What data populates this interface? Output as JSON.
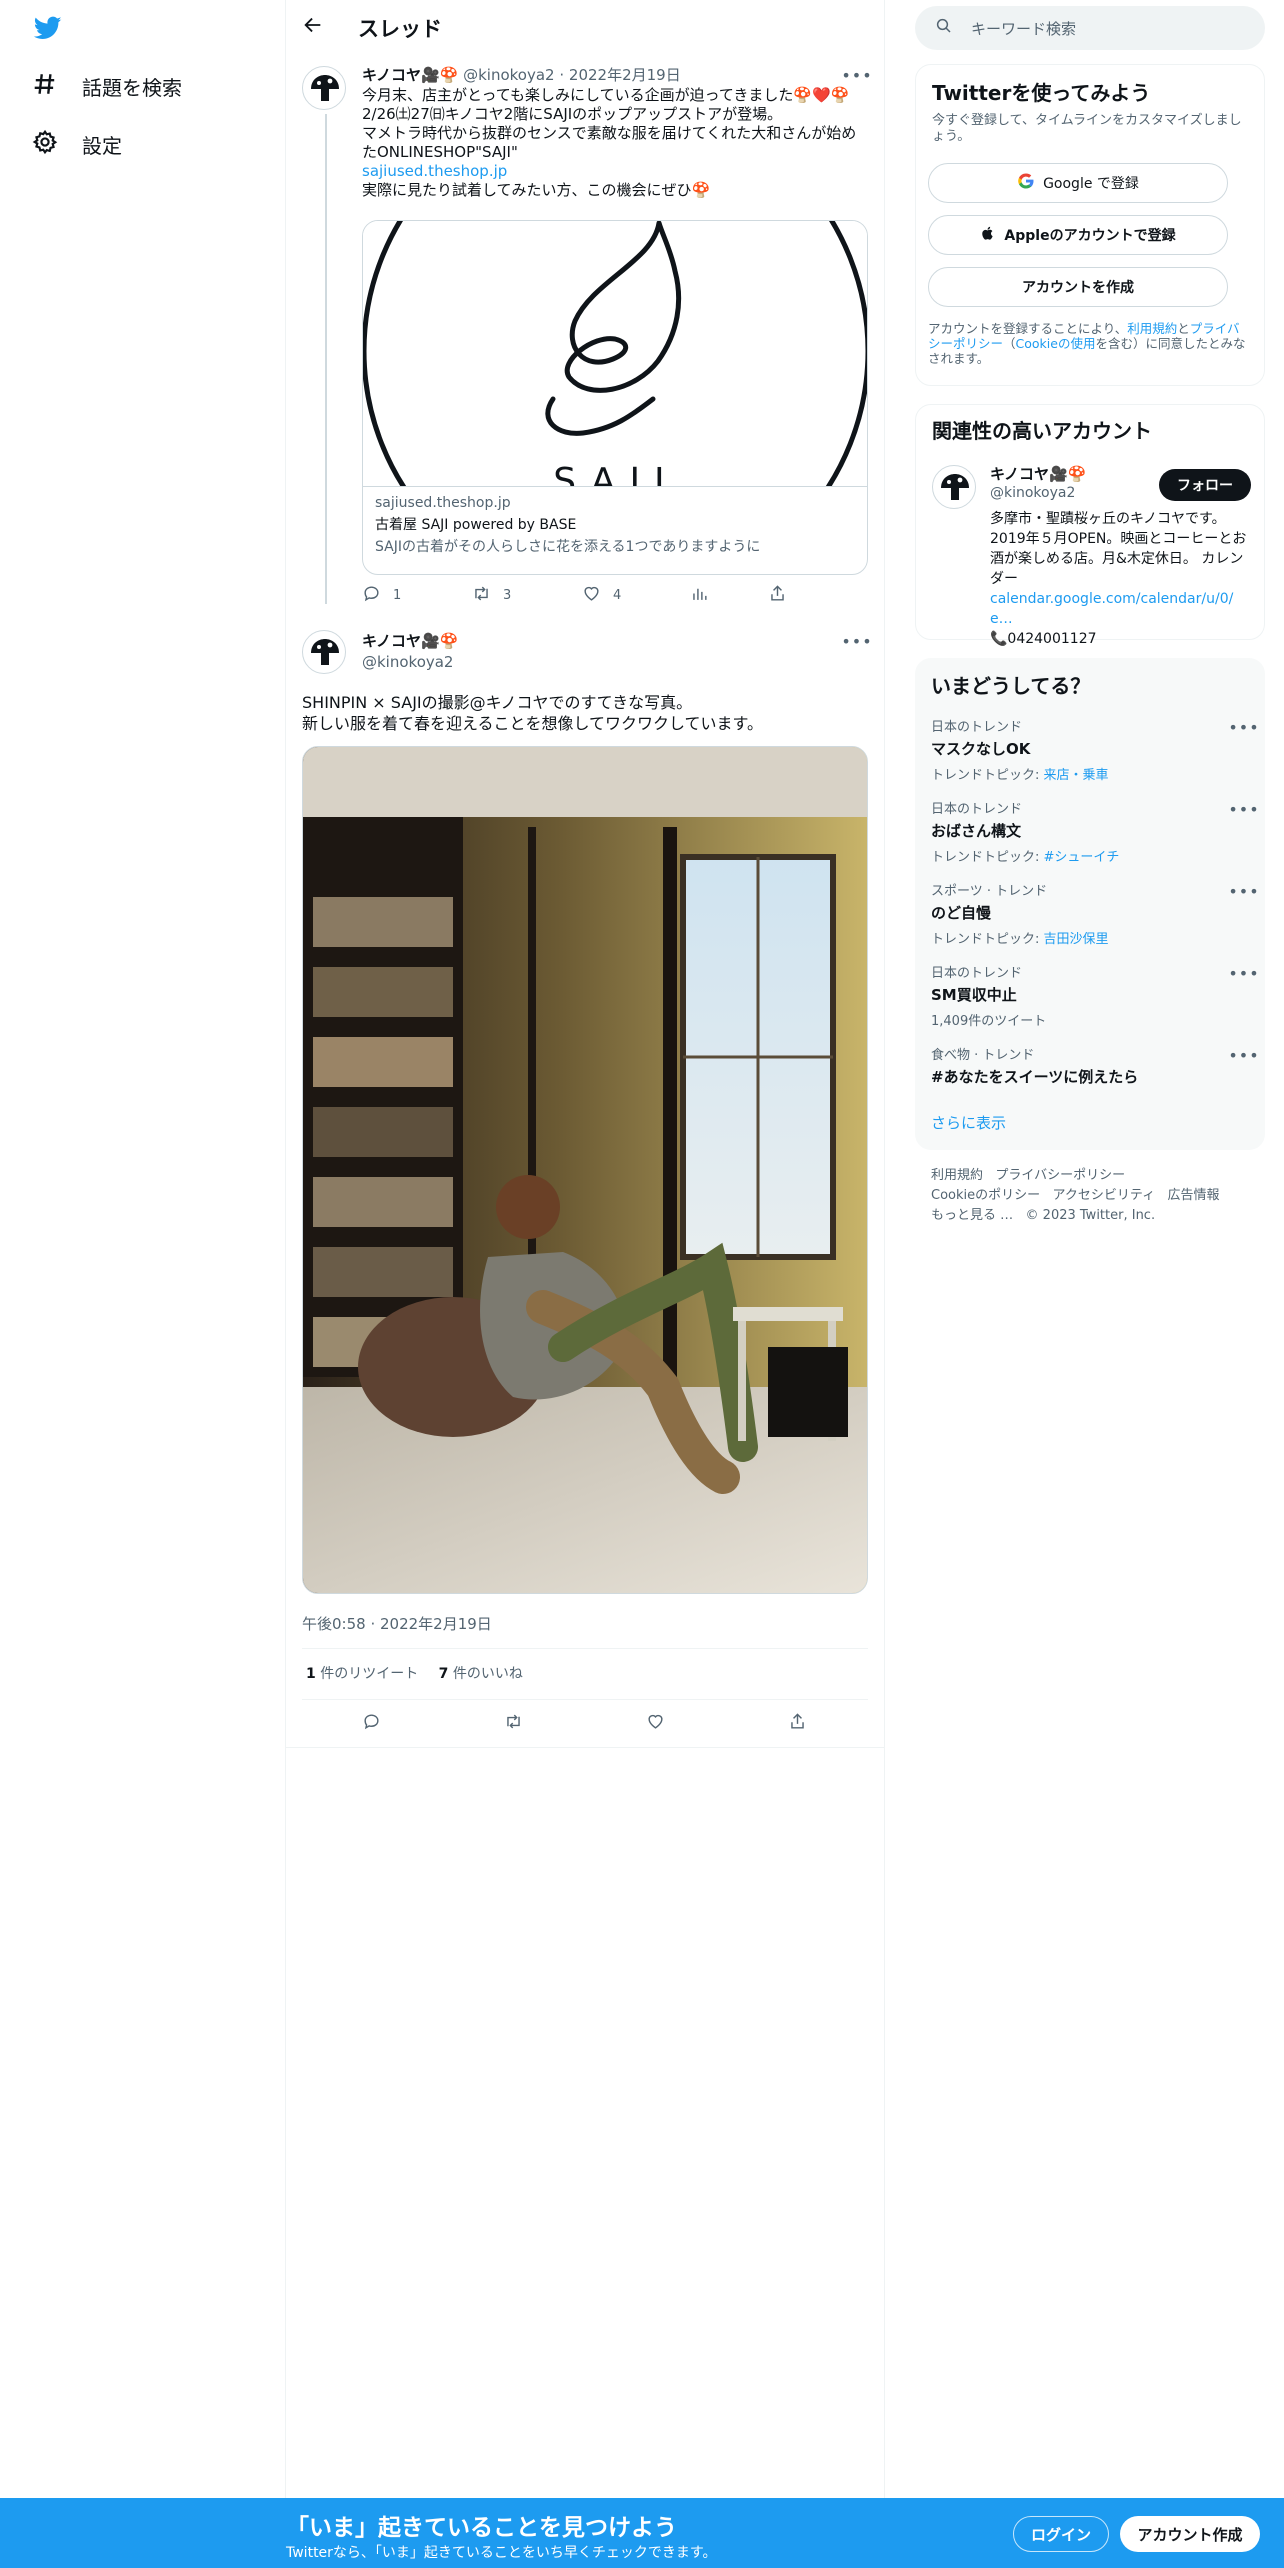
{
  "nav": {
    "items": [
      {
        "label": "話題を検索",
        "icon": "hashtag-icon"
      },
      {
        "label": "設定",
        "icon": "gear-icon"
      }
    ]
  },
  "header": {
    "title": "スレッド"
  },
  "tweet1": {
    "name": "キノコヤ🎥🍄",
    "handle": "@kinokoya2",
    "sep": "·",
    "date": "2022年2月19日",
    "lines": [
      "今月末、店主がとっても楽しみにしている企画が迫ってきました🍄❤️🍄",
      "2/26㈯27㈰キノコヤ2階にSAJIのポップアップストアが登場。",
      "マメトラ時代から抜群のセンスで素敵な服を届けてくれた大和さんが始めたONLINESHOP\"SAJI\""
    ],
    "link": "sajiused.theshop.jp",
    "line_last": "実際に見たり試着してみたい方、この機会にぜひ🍄",
    "card": {
      "image_text": "SAJI",
      "domain": "sajiused.theshop.jp",
      "title": "古着屋 SAJI powered by BASE",
      "desc": "SAJIの古着がその人らしさに花を添える1つでありますように"
    },
    "reply_count": "1",
    "retweet_count": "3",
    "like_count": "4"
  },
  "tweet2": {
    "name": "キノコヤ🎥🍄",
    "handle": "@kinokoya2",
    "text1": "SHINPIN × SAJIの撮影@キノコヤでのすてきな写真。",
    "text2": "新しい服を着て春を迎えることを想像してワクワクしています。",
    "timestamp": "午後0:58 · 2022年2月19日",
    "retweets_num": "1",
    "retweets_label": "件のリツイート",
    "likes_num": "7",
    "likes_label": "件のいいね"
  },
  "right": {
    "search_placeholder": "キーワード検索",
    "signup": {
      "title": "Twitterを使ってみよう",
      "subtitle": "今すぐ登録して、タイムラインをカスタマイズしましょう。",
      "google": "Google で登録",
      "apple": "Appleのアカウントで登録",
      "create": "アカウントを作成",
      "legal_1": "アカウントを登録することにより、",
      "legal_terms": "利用規約",
      "legal_2": "と",
      "legal_privacy": "プライバシーポリシー",
      "legal_3": "（",
      "legal_cookie": "Cookieの使用",
      "legal_4": "を含む）に同意したとみなされます。"
    },
    "relevant": {
      "title": "関連性の高いアカウント",
      "name": "キノコヤ🎥🍄",
      "handle": "@kinokoya2",
      "follow": "フォロー",
      "bio": "多摩市・聖蹟桜ヶ丘のキノコヤです。2019年５月OPEN。映画とコーヒーとお酒が楽しめる店。月&木定休日。 カレンダー",
      "bio_link": "calendar.google.com/calendar/u/0/e…",
      "phone": "📞0424001127"
    },
    "trends": {
      "title": "いまどうしてる？",
      "items": [
        {
          "meta": "日本のトレンド",
          "title": "マスクなしOK",
          "sub_prefix": "トレンドトピック: ",
          "sub_link": "来店・乗車",
          "sub": ""
        },
        {
          "meta": "日本のトレンド",
          "title": "おばさん構文",
          "sub_prefix": "トレンドトピック: ",
          "sub_link": "#シューイチ",
          "sub": ""
        },
        {
          "meta": "スポーツ · トレンド",
          "title": "のど自慢",
          "sub_prefix": "トレンドトピック: ",
          "sub_link": "吉田沙保里",
          "sub": ""
        },
        {
          "meta": "日本のトレンド",
          "title": "SM買収中止",
          "sub_prefix": "",
          "sub_link": "",
          "sub": "1,409件のツイート"
        },
        {
          "meta": "食べ物 · トレンド",
          "title": "#あなたをスイーツに例えたら",
          "sub_prefix": "",
          "sub_link": "",
          "sub": ""
        }
      ],
      "show_more": "さらに表示"
    },
    "footer": {
      "links": [
        "利用規約",
        "プライバシーポリシー",
        "Cookieのポリシー",
        "アクセシビリティ",
        "広告情報",
        "もっと見る …"
      ],
      "copyright": "© 2023 Twitter, Inc."
    }
  },
  "bottom": {
    "headline": "「いま」起きていることを見つけよう",
    "sub": "Twitterなら、「いま」起きていることをいち早くチェックできます。",
    "login": "ログイン",
    "signup": "アカウント作成"
  },
  "colors": {
    "accent": "#1d9bf0",
    "text": "#0f1419",
    "muted": "#536471",
    "border": "#eff3f4"
  }
}
